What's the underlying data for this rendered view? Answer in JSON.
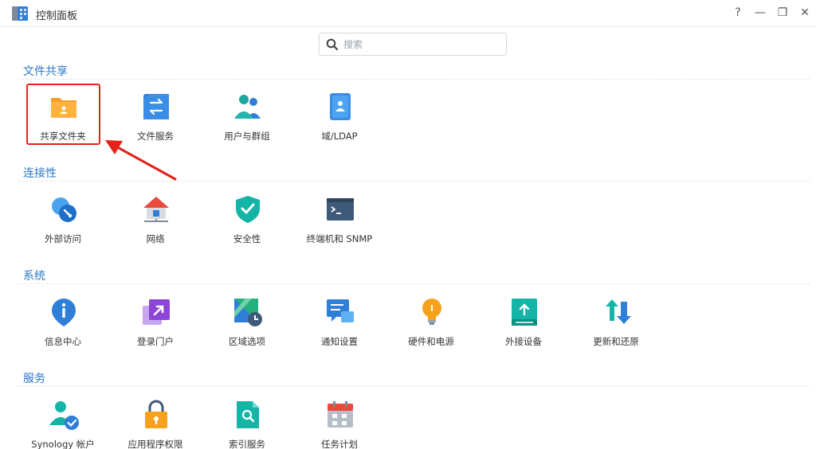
{
  "window": {
    "title": "控制面板",
    "help": "?",
    "minimize": "—",
    "maximize": "❐",
    "close": "✕"
  },
  "search": {
    "placeholder": "搜索"
  },
  "sections": [
    {
      "title": "文件共享",
      "items": [
        {
          "label": "共享文件夹",
          "icon": "shared-folder-icon"
        },
        {
          "label": "文件服务",
          "icon": "file-services-icon"
        },
        {
          "label": "用户与群组",
          "icon": "user-group-icon"
        },
        {
          "label": "域/LDAP",
          "icon": "domain-ldap-icon"
        }
      ]
    },
    {
      "title": "连接性",
      "items": [
        {
          "label": "外部访问",
          "icon": "external-access-icon"
        },
        {
          "label": "网络",
          "icon": "network-icon"
        },
        {
          "label": "安全性",
          "icon": "security-icon"
        },
        {
          "label": "终端机和 SNMP",
          "icon": "terminal-icon"
        }
      ]
    },
    {
      "title": "系统",
      "items": [
        {
          "label": "信息中心",
          "icon": "info-center-icon"
        },
        {
          "label": "登录门户",
          "icon": "login-portal-icon"
        },
        {
          "label": "区域选项",
          "icon": "regional-options-icon"
        },
        {
          "label": "通知设置",
          "icon": "notification-icon"
        },
        {
          "label": "硬件和电源",
          "icon": "hardware-power-icon"
        },
        {
          "label": "外接设备",
          "icon": "external-devices-icon"
        },
        {
          "label": "更新和还原",
          "icon": "update-restore-icon"
        }
      ]
    },
    {
      "title": "服务",
      "items": [
        {
          "label": "Synology 帐户",
          "icon": "synology-account-icon"
        },
        {
          "label": "应用程序权限",
          "icon": "app-privileges-icon"
        },
        {
          "label": "索引服务",
          "icon": "indexing-service-icon"
        },
        {
          "label": "任务计划",
          "icon": "task-scheduler-icon"
        }
      ]
    }
  ],
  "annotation": {
    "highlight_color": "#e2231a",
    "target": "共享文件夹"
  },
  "colors": {
    "accent": "#2a78c7"
  }
}
